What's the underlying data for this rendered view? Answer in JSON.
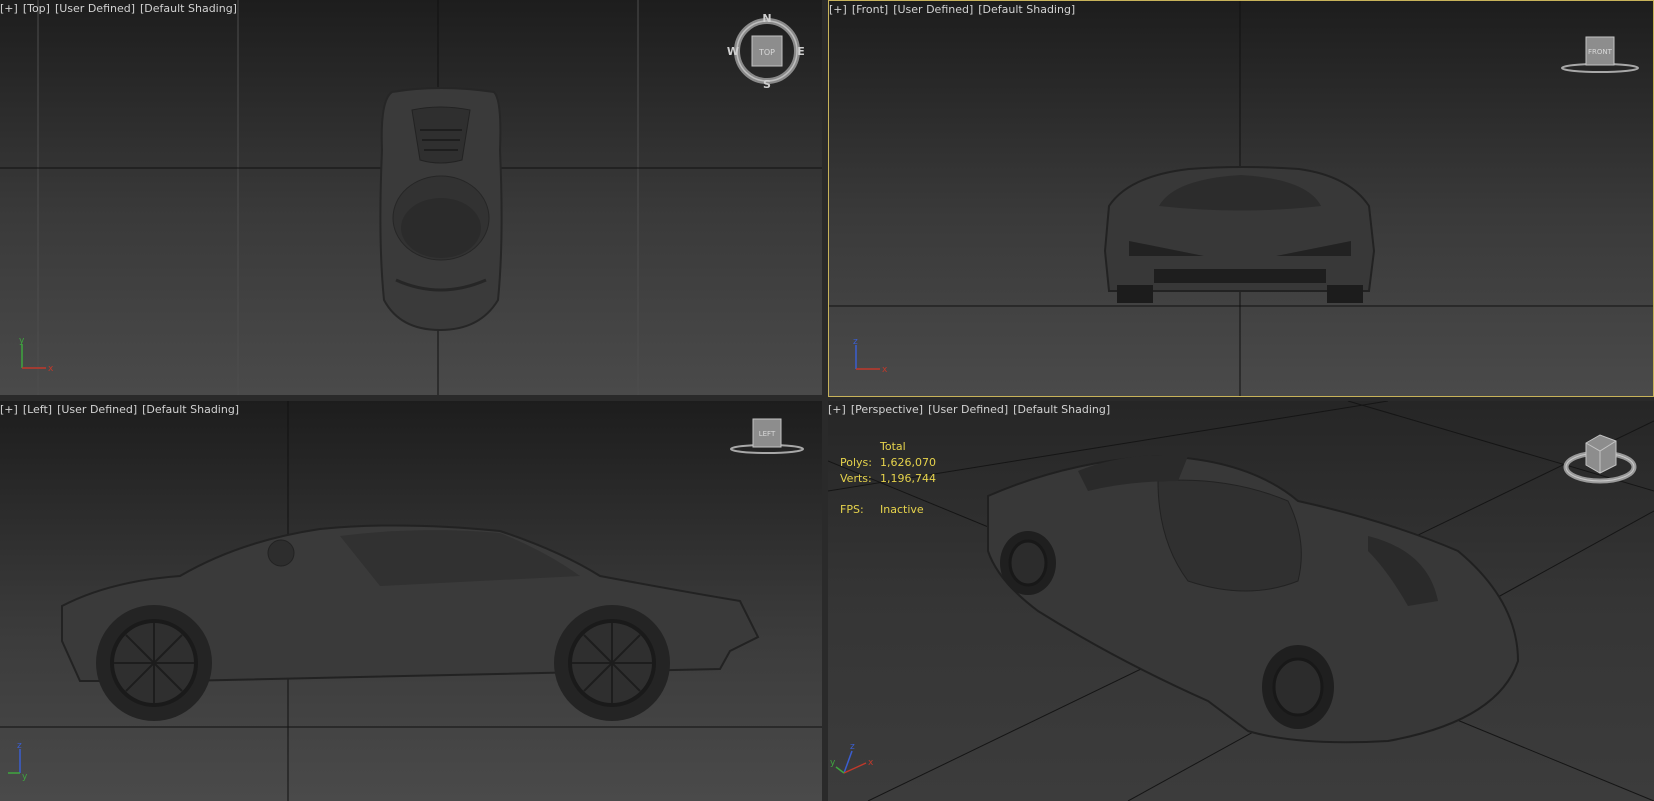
{
  "viewports": {
    "top": {
      "labels": [
        "[+]",
        "[Top]",
        "[User Defined]",
        "[Default Shading]"
      ],
      "cube": "TOP",
      "compass": {
        "n": "N",
        "s": "S",
        "e": "E",
        "w": "W"
      }
    },
    "front": {
      "labels": [
        "[+]",
        "[Front]",
        "[User Defined]",
        "[Default Shading]"
      ],
      "cube": "FRONT"
    },
    "left": {
      "labels": [
        "[+]",
        "[Left]",
        "[User Defined]",
        "[Default Shading]"
      ],
      "cube": "LEFT"
    },
    "persp": {
      "labels": [
        "[+]",
        "[Perspective]",
        "[User Defined]",
        "[Default Shading]"
      ]
    }
  },
  "stats": {
    "header": "Total",
    "polys_label": "Polys:",
    "polys_value": "1,626,070",
    "verts_label": "Verts:",
    "verts_value": "1,196,744",
    "fps_label": "FPS:",
    "fps_value": "Inactive"
  },
  "axes": {
    "x": "x",
    "y": "y",
    "z": "z"
  },
  "colors": {
    "active_border": "#c8b35a",
    "stats_text": "#e6d34c",
    "axis_x": "#c0392b",
    "axis_y": "#3fa63f",
    "axis_z": "#3a5ed1"
  }
}
